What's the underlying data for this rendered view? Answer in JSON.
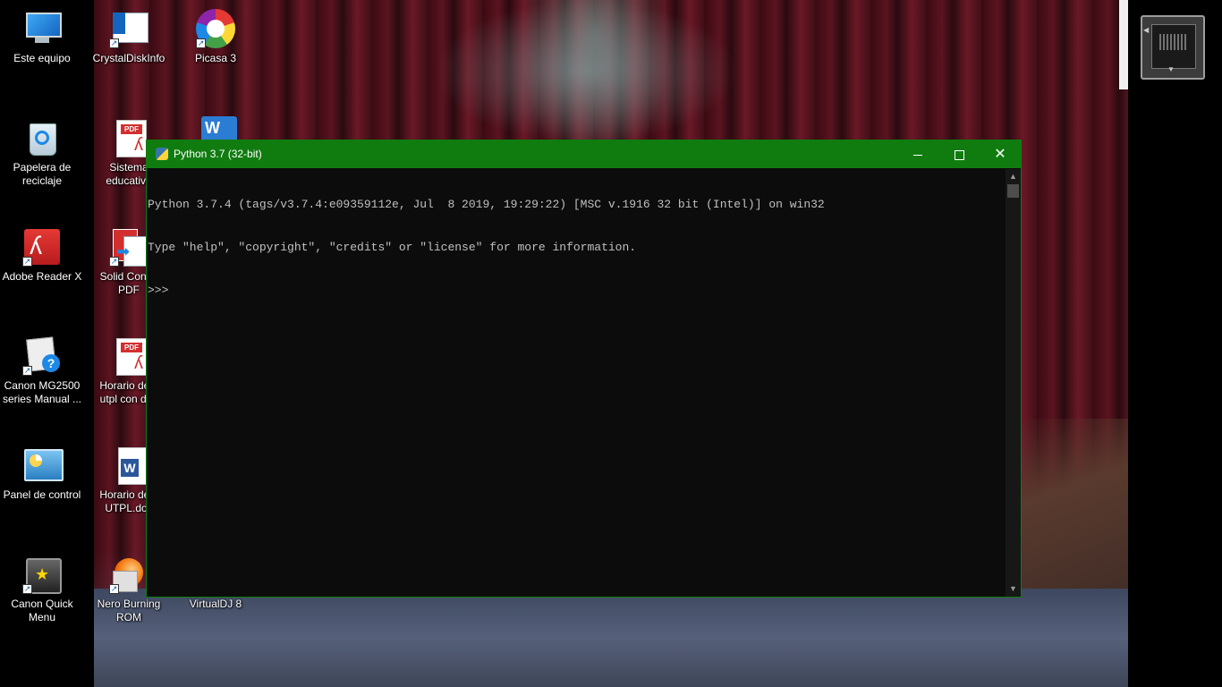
{
  "desktop": {
    "icons": [
      {
        "label": "Este equipo",
        "icon": "computer-icon"
      },
      {
        "label": "CrystalDiskInfo",
        "icon": "crystaldiskinfo-icon"
      },
      {
        "label": "Picasa 3",
        "icon": "picasa-icon"
      },
      {
        "label": "Papelera de\nreciclaje",
        "icon": "recycle-bin-icon"
      },
      {
        "label": "Sistema\neducativo",
        "icon": "pdf-document-icon"
      },
      {
        "label": "Adobe Reader X",
        "icon": "adobe-reader-icon"
      },
      {
        "label": "Solid Conve\nPDF",
        "icon": "solid-converter-icon"
      },
      {
        "label": "Canon MG2500\nseries Manual ...",
        "icon": "canon-manual-icon"
      },
      {
        "label": "Horario de c\nutpl con doc",
        "icon": "pdf-document-icon"
      },
      {
        "label": "Panel de control",
        "icon": "control-panel-icon"
      },
      {
        "label": "Horario de c\nUTPL.doc",
        "icon": "word-document-icon"
      },
      {
        "label": "Canon Quick\nMenu",
        "icon": "canon-quick-menu-icon"
      },
      {
        "label": "Nero Burning\nROM",
        "icon": "nero-icon"
      },
      {
        "label": "VirtualDJ 8",
        "icon": "virtualdj-icon"
      }
    ]
  },
  "python_window": {
    "title": "Python 3.7 (32-bit)",
    "controls": {
      "minimize": "minimize",
      "maximize": "maximize",
      "close": "✕"
    },
    "console_lines": [
      "Python 3.7.4 (tags/v3.7.4:e09359112e, Jul  8 2019, 19:29:22) [MSC v.1916 32 bit (Intel)] on win32",
      "Type \"help\", \"copyright\", \"credits\" or \"license\" for more information.",
      ">>> "
    ],
    "colors": {
      "titlebar": "#107c10",
      "background": "#0c0c0c",
      "text": "#c0c0c0"
    }
  }
}
